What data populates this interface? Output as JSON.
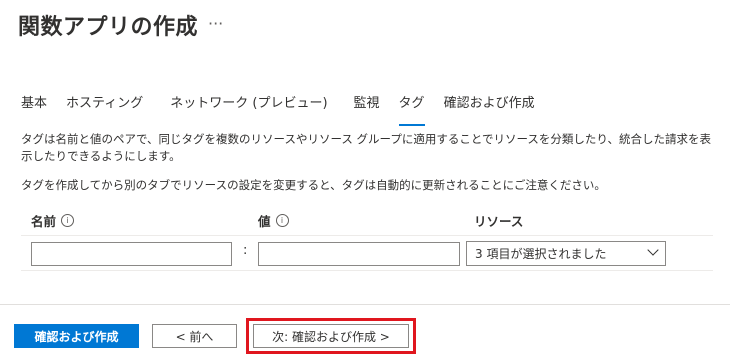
{
  "page": {
    "title": "関数アプリの作成",
    "more_label": "···"
  },
  "tabs": [
    {
      "label": "基本"
    },
    {
      "label": "ホスティング"
    },
    {
      "label": "ネットワーク (プレビュー)"
    },
    {
      "label": "監視"
    },
    {
      "label": "タグ"
    },
    {
      "label": "確認および作成"
    }
  ],
  "description": {
    "line1": "タグは名前と値のペアで、同じタグを複数のリソースやリソース グループに適用することでリソースを分類したり、統合した請求を表示したりできるようにします。",
    "line2": "タグを作成してから別のタブでリソースの設定を変更すると、タグは自動的に更新されることにご注意ください。"
  },
  "table": {
    "headers": {
      "name": "名前",
      "value": "値",
      "resource": "リソース"
    },
    "row": {
      "name_value": "",
      "separator": ":",
      "value_value": "",
      "resource_selected": "3 項目が選択されました"
    }
  },
  "footer": {
    "review_create": "確認および作成",
    "previous": "< 前へ",
    "next": "次: 確認および作成 >"
  },
  "colors": {
    "accent": "#0078d4",
    "highlight_border": "#e0161e"
  }
}
